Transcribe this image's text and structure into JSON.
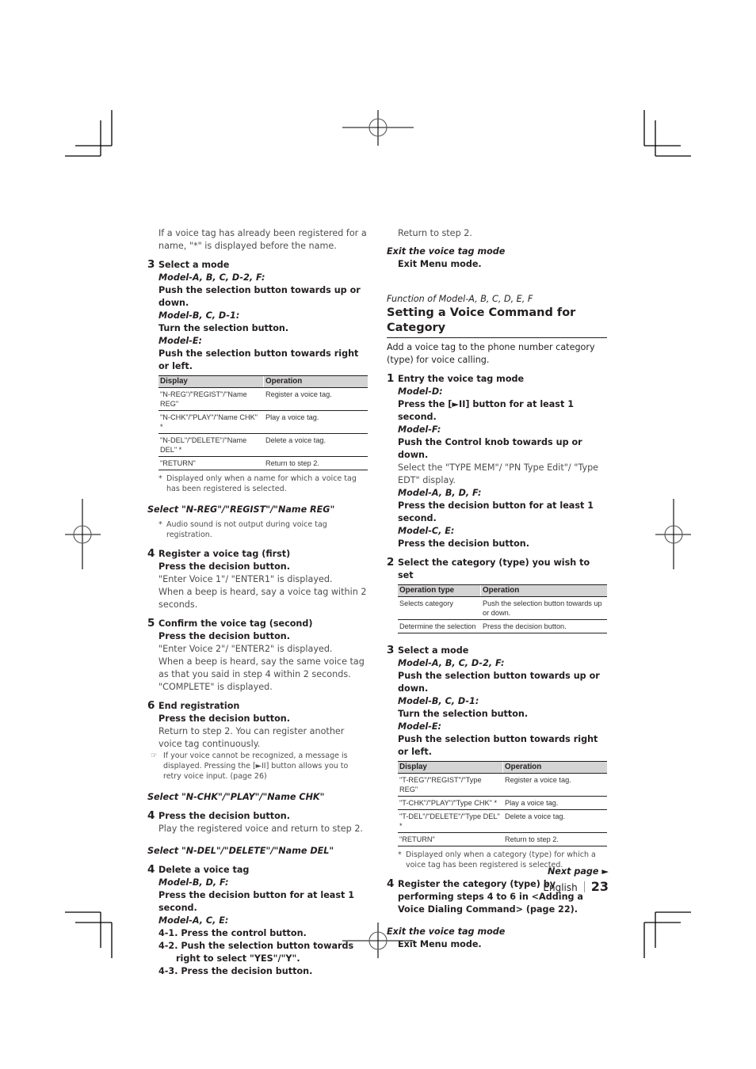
{
  "left_column": {
    "intro": "If a voice tag has already been registered for a name, \"*\" is displayed before the name.",
    "step3": {
      "num": "3",
      "title": "Select a mode",
      "models": [
        {
          "label": "Model-A, B, C, D-2, F:",
          "action": "Push the selection button towards up or down."
        },
        {
          "label": "Model-B, C, D-1:",
          "action": "Turn the selection button."
        },
        {
          "label": "Model-E:",
          "action": "Push the selection button towards right or left."
        }
      ],
      "table": {
        "headers": [
          "Display",
          "Operation"
        ],
        "rows": [
          [
            "\"N-REG\"/\"REGIST\"/\"Name REG\"",
            "Register a voice tag."
          ],
          [
            "\"N-CHK\"/\"PLAY\"/\"Name CHK\" *",
            "Play a voice tag."
          ],
          [
            "\"N-DEL\"/\"DELETE\"/\"Name DEL\" *",
            "Delete a voice tag."
          ],
          [
            "\"RETURN\"",
            "Return to step 2."
          ]
        ]
      },
      "footnote_mark": "*",
      "footnote": "Displayed only when a name for which a voice tag has been registered is selected."
    },
    "select_reg": {
      "heading": "Select \"N-REG\"/\"REGIST\"/\"Name REG\"",
      "note_mark": "*",
      "note": "Audio sound is not output during voice tag registration."
    },
    "step4": {
      "num": "4",
      "title": "Register a voice tag (first)",
      "action": "Press the decision button.",
      "lines": [
        "\"Enter Voice 1\"/ \"ENTER1\" is displayed.",
        "When a beep is heard, say a voice tag within 2 seconds."
      ]
    },
    "step5": {
      "num": "5",
      "title": "Confirm the voice tag (second)",
      "action": "Press the decision button.",
      "lines": [
        "\"Enter Voice 2\"/ \"ENTER2\" is displayed.",
        "When a beep is heard, say the same voice tag as that you said in step 4 within 2 seconds.",
        "\"COMPLETE\" is displayed."
      ]
    },
    "step6": {
      "num": "6",
      "title": "End registration",
      "action": "Press the decision button.",
      "line": "Return to step 2. You can register another voice tag continuously.",
      "note_mark": "☞",
      "note": "If your voice cannot be recognized, a message is displayed. Pressing the [►II] button allows you to retry voice input. (page 26)"
    },
    "select_chk": {
      "heading": "Select \"N-CHK\"/\"PLAY\"/\"Name CHK\"",
      "num": "4",
      "title": "Press the decision button.",
      "line": "Play the registered voice and return to step 2."
    },
    "select_del": {
      "heading": "Select \"N-DEL\"/\"DELETE\"/\"Name DEL\"",
      "num": "4",
      "title": "Delete a voice tag",
      "model1": {
        "label": "Model-B, D, F:",
        "action": "Press the decision button for at least 1 second."
      },
      "model2": {
        "label": "Model-A, C, E:"
      },
      "substeps": [
        "4-1. Press the control button.",
        "4-2. Push the selection button towards right to select \"YES\"/\"Y\".",
        "4-3. Press the decision button."
      ]
    }
  },
  "right_column": {
    "top_line": "Return to step 2.",
    "exit1": {
      "heading": "Exit the voice tag mode",
      "action": "Exit Menu mode."
    },
    "function_label": "Function of Model-A, B, C, D, E, F",
    "title": "Setting a Voice Command for Category",
    "intro": "Add a voice tag to the phone number category (type) for voice calling.",
    "step1": {
      "num": "1",
      "title": "Entry the voice tag mode",
      "modelD": {
        "label": "Model-D:",
        "action": "Press the [►II] button for at least 1 second."
      },
      "modelF": {
        "label": "Model-F:",
        "action": "Push the Control knob towards up or down.",
        "note": "Select the \"TYPE MEM\"/ \"PN Type Edit\"/ \"Type EDT\" display."
      },
      "modelABDF": {
        "label": "Model-A, B, D, F:",
        "action": "Press the decision button for at least 1 second."
      },
      "modelCE": {
        "label": "Model-C, E:",
        "action": "Press the decision button."
      }
    },
    "step2": {
      "num": "2",
      "title": "Select the category (type) you wish to set",
      "table": {
        "headers": [
          "Operation type",
          "Operation"
        ],
        "rows": [
          [
            "Selects category",
            "Push the selection button towards up or down."
          ],
          [
            "Determine the selection",
            "Press the decision button."
          ]
        ]
      }
    },
    "step3": {
      "num": "3",
      "title": "Select a mode",
      "models": [
        {
          "label": "Model-A, B, C, D-2, F:",
          "action": "Push the selection button towards up or down."
        },
        {
          "label": "Model-B, C, D-1:",
          "action": "Turn the selection button."
        },
        {
          "label": "Model-E:",
          "action": "Push the selection button towards right or left."
        }
      ],
      "table": {
        "headers": [
          "Display",
          "Operation"
        ],
        "rows": [
          [
            "\"T-REG\"/\"REGIST\"/\"Type REG\"",
            "Register a voice tag."
          ],
          [
            "\"T-CHK\"/\"PLAY\"/\"Type CHK\" *",
            "Play a voice tag."
          ],
          [
            "\"T-DEL\"/\"DELETE\"/\"Type DEL\" *",
            "Delete a voice tag."
          ],
          [
            "\"RETURN\"",
            "Return to step 2."
          ]
        ]
      },
      "footnote_mark": "*",
      "footnote": "Displayed only when a category (type) for which a voice tag has been registered is selected."
    },
    "step4": {
      "num": "4",
      "title": "Register the category (type) by performing steps 4 to 6 in <Adding a Voice Dialing Command> (page 22)."
    },
    "exit2": {
      "heading": "Exit the voice tag mode",
      "action": "Exit Menu mode."
    }
  },
  "footer": {
    "next_page": "Next page ►",
    "language": "English",
    "page_number": "23"
  }
}
